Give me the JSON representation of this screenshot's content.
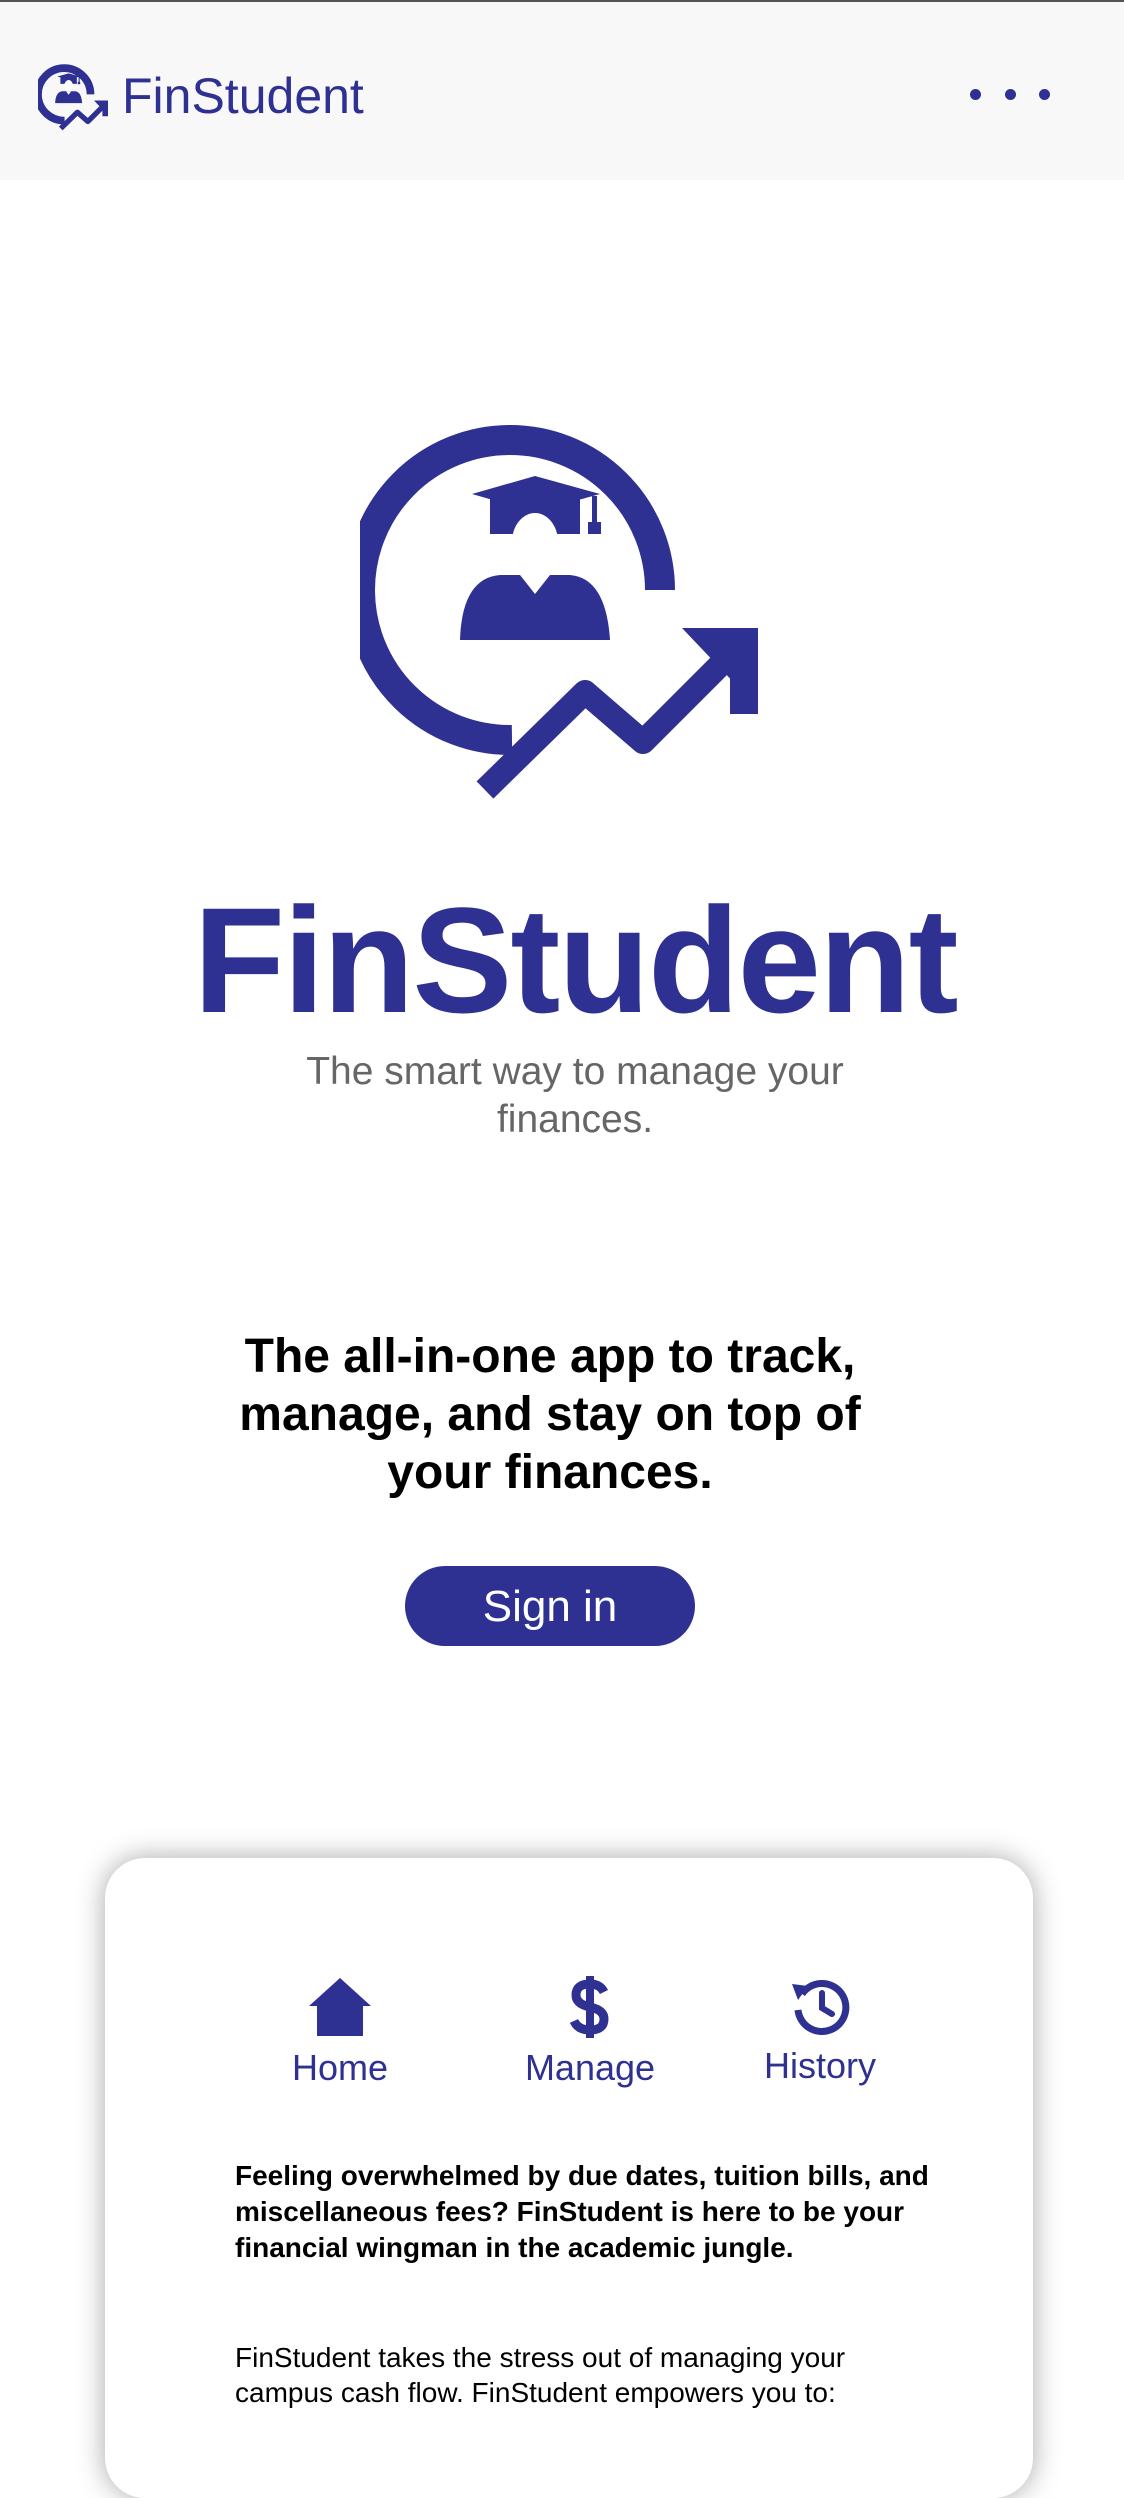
{
  "header": {
    "brand": "FinStudent"
  },
  "hero": {
    "title": "FinStudent",
    "subtitle": "The smart way to manage your finances."
  },
  "tagline": "The all-in-one app to track, manage, and stay on top of your finances.",
  "signin_label": "Sign in",
  "card": {
    "nav": [
      {
        "label": "Home",
        "icon": "home-icon"
      },
      {
        "label": "Manage",
        "icon": "dollar-icon"
      },
      {
        "label": "History",
        "icon": "history-icon"
      }
    ],
    "intro": "Feeling overwhelmed by due dates, tuition bills, and miscellaneous fees? FinStudent is here to be your financial wingman in the academic jungle.",
    "body": "FinStudent takes the stress out of managing your campus cash flow.  FinStudent empowers you to:"
  },
  "colors": {
    "brand": "#2e3192",
    "subtitle": "#666666",
    "header_bg": "#f8f8f8"
  }
}
